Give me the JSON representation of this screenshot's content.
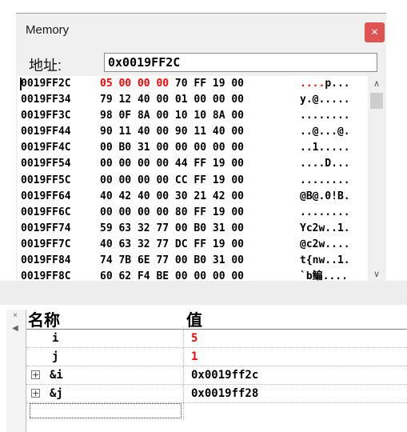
{
  "memory": {
    "title": "Memory",
    "close_glyph": "×",
    "address_label": "地址:",
    "address_value": "0x0019FF2C",
    "rows": [
      {
        "addr": "0019FF2C",
        "hex_hi": "05 00 00 00",
        "hex_rest": " 70 FF 19 00",
        "ascii_hi": "....",
        "ascii_rest": "p..."
      },
      {
        "addr": "0019FF34",
        "hex_hi": "",
        "hex_rest": "79 12 40 00 01 00 00 00",
        "ascii_hi": "",
        "ascii_rest": "y.@....."
      },
      {
        "addr": "0019FF3C",
        "hex_hi": "",
        "hex_rest": "98 0F 8A 00 10 10 8A 00",
        "ascii_hi": "",
        "ascii_rest": "........"
      },
      {
        "addr": "0019FF44",
        "hex_hi": "",
        "hex_rest": "90 11 40 00 90 11 40 00",
        "ascii_hi": "",
        "ascii_rest": "..@...@."
      },
      {
        "addr": "0019FF4C",
        "hex_hi": "",
        "hex_rest": "00 B0 31 00 00 00 00 00",
        "ascii_hi": "",
        "ascii_rest": "..1....."
      },
      {
        "addr": "0019FF54",
        "hex_hi": "",
        "hex_rest": "00 00 00 00 44 FF 19 00",
        "ascii_hi": "",
        "ascii_rest": "....D..."
      },
      {
        "addr": "0019FF5C",
        "hex_hi": "",
        "hex_rest": "00 00 00 00 CC FF 19 00",
        "ascii_hi": "",
        "ascii_rest": "........"
      },
      {
        "addr": "0019FF64",
        "hex_hi": "",
        "hex_rest": "40 42 40 00 30 21 42 00",
        "ascii_hi": "",
        "ascii_rest": "@B@.0!B."
      },
      {
        "addr": "0019FF6C",
        "hex_hi": "",
        "hex_rest": "00 00 00 00 80 FF 19 00",
        "ascii_hi": "",
        "ascii_rest": "........"
      },
      {
        "addr": "0019FF74",
        "hex_hi": "",
        "hex_rest": "59 63 32 77 00 B0 31 00",
        "ascii_hi": "",
        "ascii_rest": "Yc2w..1."
      },
      {
        "addr": "0019FF7C",
        "hex_hi": "",
        "hex_rest": "40 63 32 77 DC FF 19 00",
        "ascii_hi": "",
        "ascii_rest": "@c2w...."
      },
      {
        "addr": "0019FF84",
        "hex_hi": "",
        "hex_rest": "74 7B 6E 77 00 B0 31 00",
        "ascii_hi": "",
        "ascii_rest": "t{nw..1."
      },
      {
        "addr": "0019FF8C",
        "hex_hi": "",
        "hex_rest": "60 62 F4 BE 00 00 00 00",
        "ascii_hi": "",
        "ascii_rest": "`b鳊...."
      }
    ],
    "scroll_up_glyph": "∧",
    "scroll_down_glyph": "∨",
    "highlight_color": "#ff0000"
  },
  "watch": {
    "side_close_glyph": "×",
    "side_arrow_glyph": "◀",
    "columns": {
      "name": "名称",
      "value": "值"
    },
    "rows": [
      {
        "name": "i",
        "value": "5",
        "expandable": false,
        "changed": true
      },
      {
        "name": "j",
        "value": "1",
        "expandable": false,
        "changed": true
      },
      {
        "name": "&i",
        "value": "0x0019ff2c",
        "expandable": true,
        "changed": false
      },
      {
        "name": "&j",
        "value": "0x0019ff28",
        "expandable": true,
        "changed": false
      }
    ],
    "expand_glyph": "+"
  }
}
